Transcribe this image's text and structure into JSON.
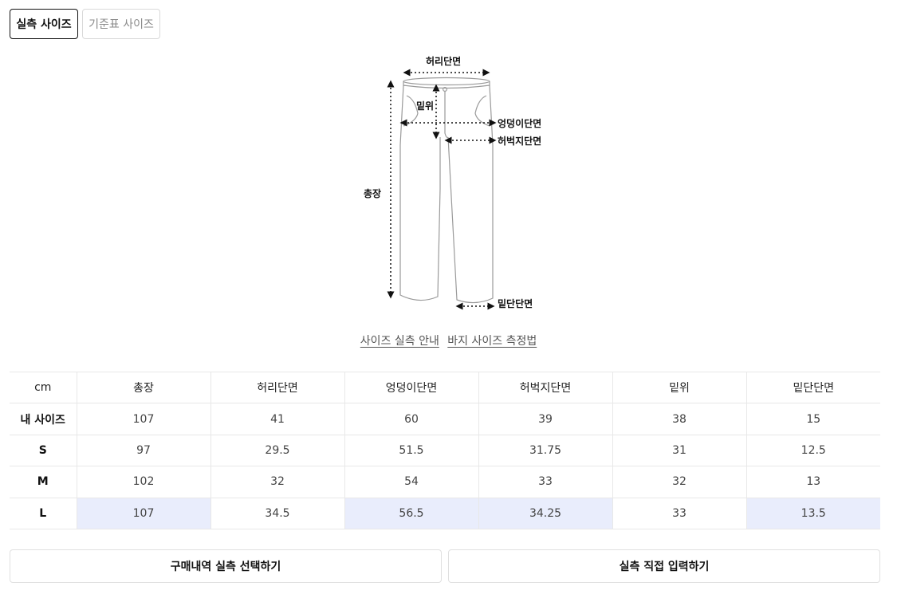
{
  "tabs": {
    "measured": "실측 사이즈",
    "standard": "기준표 사이즈"
  },
  "diagram": {
    "waist": "허리단면",
    "rise": "밑위",
    "hip": "엉덩이단면",
    "thigh": "허벅지단면",
    "length": "총장",
    "hem": "밑단단면"
  },
  "links": {
    "guide": "사이즈 실측 안내",
    "measure": "바지 사이즈 측정법"
  },
  "table": {
    "headers": [
      "cm",
      "총장",
      "허리단면",
      "엉덩이단면",
      "허벅지단면",
      "밑위",
      "밑단단면"
    ],
    "rows": [
      [
        "내 사이즈",
        "107",
        "41",
        "60",
        "39",
        "38",
        "15"
      ],
      [
        "S",
        "97",
        "29.5",
        "51.5",
        "31.75",
        "31",
        "12.5"
      ],
      [
        "M",
        "102",
        "32",
        "54",
        "33",
        "32",
        "13"
      ],
      [
        "L",
        "107",
        "34.5",
        "56.5",
        "34.25",
        "33",
        "13.5"
      ]
    ]
  },
  "buttons": {
    "purchase": "구매내역 실측 선택하기",
    "manual": "실측 직접 입력하기"
  }
}
